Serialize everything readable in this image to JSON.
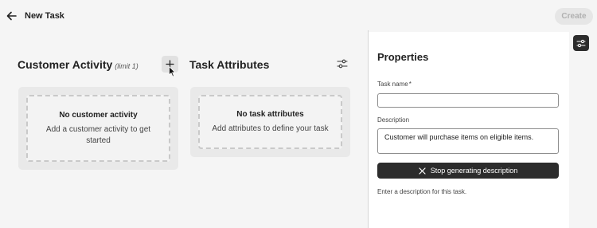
{
  "header": {
    "back_icon": "arrow-left-icon",
    "title": "New Task",
    "create_label": "Create"
  },
  "customer_activity": {
    "title": "Customer Activity",
    "limit": "(limit 1)",
    "add_icon": "plus-icon",
    "empty_title": "No customer activity",
    "empty_text": "Add a customer activity to get started"
  },
  "task_attributes": {
    "title": "Task Attributes",
    "filter_icon": "sliders-icon",
    "empty_title": "No task attributes",
    "empty_text": "Add attributes to define your task"
  },
  "properties": {
    "title": "Properties",
    "task_name_label": "Task name",
    "required_mark": "*",
    "task_name_value": "",
    "description_label": "Description",
    "description_value": "Customer will purchase items on eligible items.",
    "stop_label": "Stop generating description",
    "stop_icon": "close-icon",
    "help_text": "Enter a description for this task."
  },
  "side_panel": {
    "toggle_icon": "sliders-icon"
  },
  "colors": {
    "background": "#f5f5f5",
    "panel": "#ffffff",
    "dark_button": "#2c2c2c",
    "disabled_button": "#e6e6e6"
  }
}
